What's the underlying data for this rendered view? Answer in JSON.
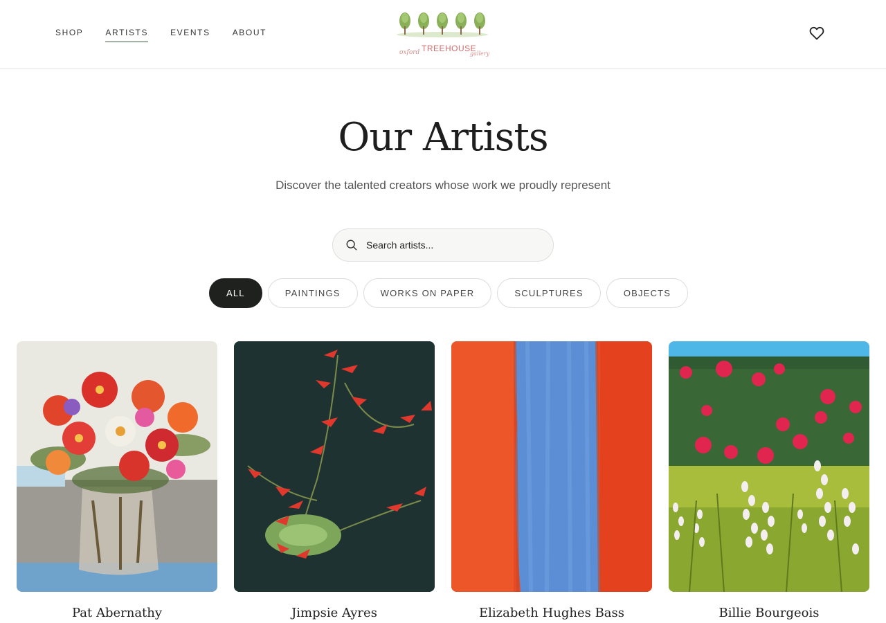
{
  "nav": {
    "items": [
      {
        "label": "SHOP",
        "active": false
      },
      {
        "label": "ARTISTS",
        "active": true
      },
      {
        "label": "EVENTS",
        "active": false
      },
      {
        "label": "ABOUT",
        "active": false
      }
    ]
  },
  "logo": {
    "text_left": "oxford",
    "text_main": "TREEHOUSE",
    "text_right": "gallery"
  },
  "header_icons": {
    "favorites": "heart-icon"
  },
  "hero": {
    "title": "Our Artists",
    "subtitle": "Discover the talented creators whose work we proudly represent"
  },
  "search": {
    "placeholder": "Search artists...",
    "icon": "search-icon"
  },
  "filters": [
    {
      "label": "ALL",
      "active": true
    },
    {
      "label": "PAINTINGS",
      "active": false
    },
    {
      "label": "WORKS ON PAPER",
      "active": false
    },
    {
      "label": "SCULPTURES",
      "active": false
    },
    {
      "label": "OBJECTS",
      "active": false
    }
  ],
  "artists": [
    {
      "name": "Pat Abernathy"
    },
    {
      "name": "Jimpsie Ayres"
    },
    {
      "name": "Elizabeth Hughes Bass"
    },
    {
      "name": "Billie Bourgeois"
    }
  ],
  "colors": {
    "accent": "#3c5a40",
    "chip_active_bg": "#1f211f",
    "border": "#e2e2e2"
  }
}
